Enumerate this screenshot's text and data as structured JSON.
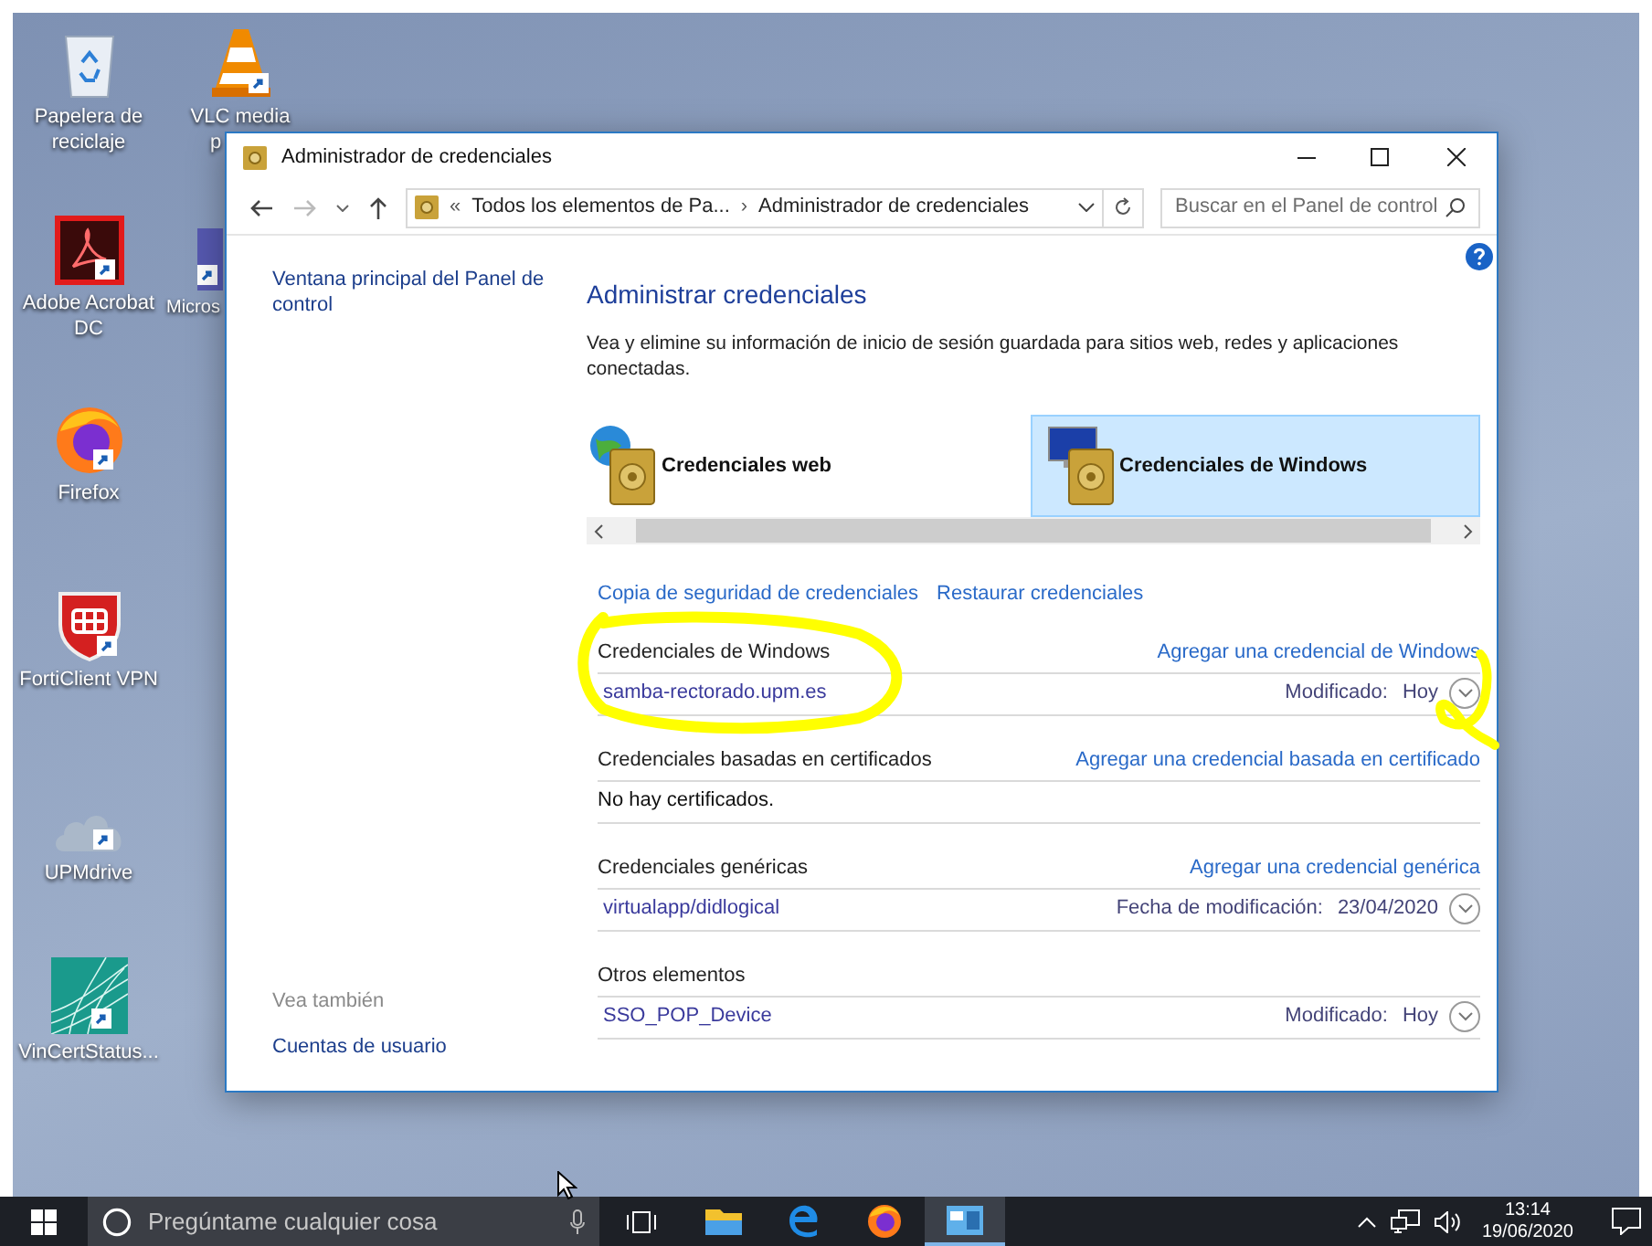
{
  "desktop_icons": [
    {
      "kind": "recycle",
      "label_lines": [
        "Papelera de",
        "reciclaje"
      ],
      "shortcut": false
    },
    {
      "kind": "vlc",
      "label_lines": [
        "VLC media",
        "p"
      ],
      "shortcut": true
    },
    {
      "kind": "acrobat",
      "label_lines": [
        "Adobe Acrobat",
        "DC"
      ],
      "shortcut": true
    },
    {
      "kind": "teams",
      "label_lines": [
        "Micros"
      ],
      "shortcut": true
    },
    {
      "kind": "firefox",
      "label_lines": [
        "Firefox"
      ],
      "shortcut": true
    },
    {
      "kind": "forticlient",
      "label_lines": [
        "FortiClient VPN"
      ],
      "shortcut": true
    },
    {
      "kind": "cloud",
      "label_lines": [
        "UPMdrive"
      ],
      "shortcut": true
    },
    {
      "kind": "vincert",
      "label_lines": [
        "VinCertStatus..."
      ],
      "shortcut": true
    }
  ],
  "window": {
    "title": "Administrador de credenciales",
    "address": {
      "overflow": "«",
      "crumbs": [
        "Todos los elementos de Pa...",
        "Administrador de credenciales"
      ],
      "separator": "›"
    },
    "search": {
      "placeholder": "Buscar en el Panel de control"
    },
    "sidebar": {
      "link": "Ventana principal del Panel de control",
      "see_also_heading": "Vea también",
      "see_also_links": [
        "Cuentas de usuario"
      ]
    },
    "heading": "Administrar credenciales",
    "description": "Vea y elimine su información de inicio de sesión guardada para sitios web, redes y aplicaciones conectadas.",
    "tiles": [
      {
        "kind": "web",
        "label": "Credenciales web",
        "selected": false
      },
      {
        "kind": "windows",
        "label": "Credenciales de Windows",
        "selected": true
      }
    ],
    "actions": [
      "Copia de seguridad de credenciales",
      "Restaurar credenciales"
    ],
    "sections": [
      {
        "title": "Credenciales de Windows",
        "add_link": "Agregar una credencial de Windows",
        "items": [
          {
            "kind": "credential",
            "name": "samba-rectorado.upm.es",
            "modified_label": "Modificado:",
            "modified_value": "Hoy"
          }
        ]
      },
      {
        "title": "Credenciales basadas en certificados",
        "add_link": "Agregar una credencial basada en certificado",
        "items": [
          {
            "kind": "empty",
            "text": "No hay certificados."
          }
        ]
      },
      {
        "title": "Credenciales genéricas",
        "add_link": "Agregar una credencial genérica",
        "items": [
          {
            "kind": "credential",
            "name": "virtualapp/didlogical",
            "modified_label": "Fecha de modificación:",
            "modified_value": "23/04/2020"
          }
        ]
      },
      {
        "title": "Otros elementos",
        "items": [
          {
            "kind": "credential",
            "name": "SSO_POP_Device",
            "modified_label": "Modificado:",
            "modified_value": "Hoy"
          }
        ]
      }
    ]
  },
  "taskbar": {
    "search_placeholder": "Pregúntame cualquier cosa",
    "apps": [
      {
        "kind": "explorer",
        "active": false
      },
      {
        "kind": "edge",
        "active": false
      },
      {
        "kind": "firefox",
        "active": false
      },
      {
        "kind": "control-panel",
        "active": true
      }
    ],
    "time": "13:14",
    "date": "19/06/2020"
  }
}
